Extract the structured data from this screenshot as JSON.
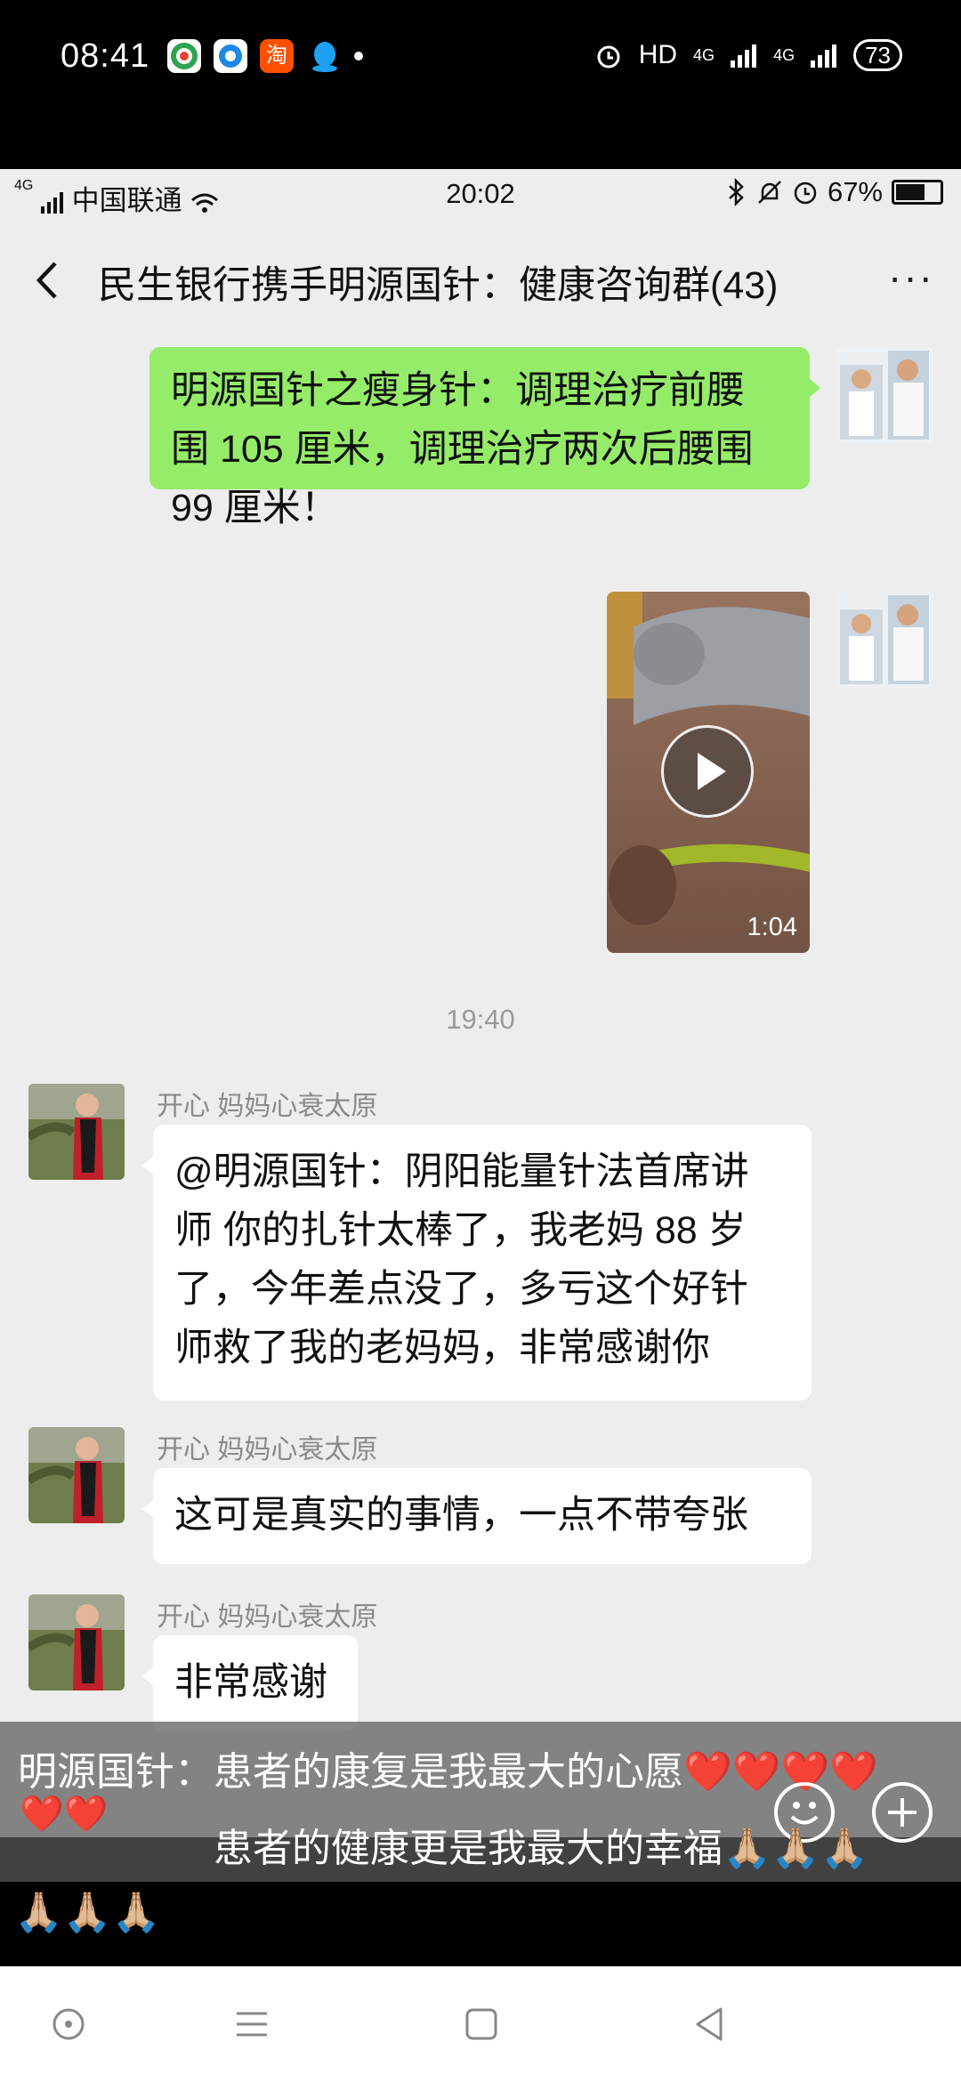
{
  "phone_status": {
    "time": "08:41",
    "hd": "HD",
    "network1": "4G",
    "network2": "4G",
    "battery": "73",
    "app_icons": [
      "browser-icon",
      "qq-browser-icon",
      "taobao-icon",
      "qq-icon"
    ]
  },
  "inner_status": {
    "carrier": "中国联通",
    "signal": "4G",
    "time": "20:02",
    "battery": "67%"
  },
  "chat": {
    "title": "民生银行携手明源国针：健康咨询群(43)",
    "more": "···"
  },
  "messages": {
    "m1_lines": [
      "明源国针之瘦身针：调理治疗前腰",
      "围 105 厘米，调理治疗两次后腰围",
      "99 厘米！"
    ],
    "video_duration": "1:04",
    "timestamp": "19:40",
    "sender_name": "开心  妈妈心衰太原",
    "m3_lines": [
      "@明源国针：阴阳能量针法首席讲",
      "师  你的扎针太棒了，我老妈 88 岁",
      "了，今年差点没了，多亏这个好针",
      "师救了我的老妈妈，非常感谢你"
    ],
    "m4": "这可是真实的事情，一点不带夸张",
    "m5": "非常感谢"
  },
  "overlay": {
    "line1": "明源国针：患者的康复是我最大的心愿❤️❤️❤️❤️",
    "line1_hearts": "❤️❤️",
    "line2": "患者的健康更是我最大的幸福🙏🏼🙏🏼🙏🏼",
    "line3": "🙏🏼🙏🏼🙏🏼"
  },
  "colors": {
    "bubble_green": "#95ec69",
    "chat_bg": "#ededed"
  }
}
